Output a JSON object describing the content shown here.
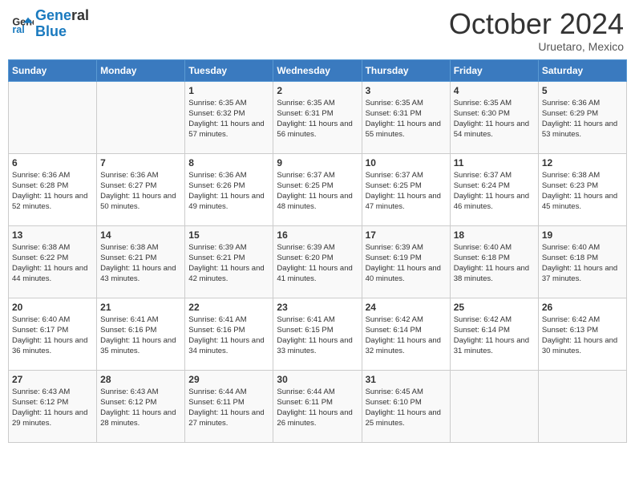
{
  "logo": {
    "line1": "General",
    "line2": "Blue"
  },
  "title": "October 2024",
  "subtitle": "Uruetaro, Mexico",
  "days_of_week": [
    "Sunday",
    "Monday",
    "Tuesday",
    "Wednesday",
    "Thursday",
    "Friday",
    "Saturday"
  ],
  "weeks": [
    [
      {
        "day": "",
        "info": ""
      },
      {
        "day": "",
        "info": ""
      },
      {
        "day": "1",
        "info": "Sunrise: 6:35 AM\nSunset: 6:32 PM\nDaylight: 11 hours and 57 minutes."
      },
      {
        "day": "2",
        "info": "Sunrise: 6:35 AM\nSunset: 6:31 PM\nDaylight: 11 hours and 56 minutes."
      },
      {
        "day": "3",
        "info": "Sunrise: 6:35 AM\nSunset: 6:31 PM\nDaylight: 11 hours and 55 minutes."
      },
      {
        "day": "4",
        "info": "Sunrise: 6:35 AM\nSunset: 6:30 PM\nDaylight: 11 hours and 54 minutes."
      },
      {
        "day": "5",
        "info": "Sunrise: 6:36 AM\nSunset: 6:29 PM\nDaylight: 11 hours and 53 minutes."
      }
    ],
    [
      {
        "day": "6",
        "info": "Sunrise: 6:36 AM\nSunset: 6:28 PM\nDaylight: 11 hours and 52 minutes."
      },
      {
        "day": "7",
        "info": "Sunrise: 6:36 AM\nSunset: 6:27 PM\nDaylight: 11 hours and 50 minutes."
      },
      {
        "day": "8",
        "info": "Sunrise: 6:36 AM\nSunset: 6:26 PM\nDaylight: 11 hours and 49 minutes."
      },
      {
        "day": "9",
        "info": "Sunrise: 6:37 AM\nSunset: 6:25 PM\nDaylight: 11 hours and 48 minutes."
      },
      {
        "day": "10",
        "info": "Sunrise: 6:37 AM\nSunset: 6:25 PM\nDaylight: 11 hours and 47 minutes."
      },
      {
        "day": "11",
        "info": "Sunrise: 6:37 AM\nSunset: 6:24 PM\nDaylight: 11 hours and 46 minutes."
      },
      {
        "day": "12",
        "info": "Sunrise: 6:38 AM\nSunset: 6:23 PM\nDaylight: 11 hours and 45 minutes."
      }
    ],
    [
      {
        "day": "13",
        "info": "Sunrise: 6:38 AM\nSunset: 6:22 PM\nDaylight: 11 hours and 44 minutes."
      },
      {
        "day": "14",
        "info": "Sunrise: 6:38 AM\nSunset: 6:21 PM\nDaylight: 11 hours and 43 minutes."
      },
      {
        "day": "15",
        "info": "Sunrise: 6:39 AM\nSunset: 6:21 PM\nDaylight: 11 hours and 42 minutes."
      },
      {
        "day": "16",
        "info": "Sunrise: 6:39 AM\nSunset: 6:20 PM\nDaylight: 11 hours and 41 minutes."
      },
      {
        "day": "17",
        "info": "Sunrise: 6:39 AM\nSunset: 6:19 PM\nDaylight: 11 hours and 40 minutes."
      },
      {
        "day": "18",
        "info": "Sunrise: 6:40 AM\nSunset: 6:18 PM\nDaylight: 11 hours and 38 minutes."
      },
      {
        "day": "19",
        "info": "Sunrise: 6:40 AM\nSunset: 6:18 PM\nDaylight: 11 hours and 37 minutes."
      }
    ],
    [
      {
        "day": "20",
        "info": "Sunrise: 6:40 AM\nSunset: 6:17 PM\nDaylight: 11 hours and 36 minutes."
      },
      {
        "day": "21",
        "info": "Sunrise: 6:41 AM\nSunset: 6:16 PM\nDaylight: 11 hours and 35 minutes."
      },
      {
        "day": "22",
        "info": "Sunrise: 6:41 AM\nSunset: 6:16 PM\nDaylight: 11 hours and 34 minutes."
      },
      {
        "day": "23",
        "info": "Sunrise: 6:41 AM\nSunset: 6:15 PM\nDaylight: 11 hours and 33 minutes."
      },
      {
        "day": "24",
        "info": "Sunrise: 6:42 AM\nSunset: 6:14 PM\nDaylight: 11 hours and 32 minutes."
      },
      {
        "day": "25",
        "info": "Sunrise: 6:42 AM\nSunset: 6:14 PM\nDaylight: 11 hours and 31 minutes."
      },
      {
        "day": "26",
        "info": "Sunrise: 6:42 AM\nSunset: 6:13 PM\nDaylight: 11 hours and 30 minutes."
      }
    ],
    [
      {
        "day": "27",
        "info": "Sunrise: 6:43 AM\nSunset: 6:12 PM\nDaylight: 11 hours and 29 minutes."
      },
      {
        "day": "28",
        "info": "Sunrise: 6:43 AM\nSunset: 6:12 PM\nDaylight: 11 hours and 28 minutes."
      },
      {
        "day": "29",
        "info": "Sunrise: 6:44 AM\nSunset: 6:11 PM\nDaylight: 11 hours and 27 minutes."
      },
      {
        "day": "30",
        "info": "Sunrise: 6:44 AM\nSunset: 6:11 PM\nDaylight: 11 hours and 26 minutes."
      },
      {
        "day": "31",
        "info": "Sunrise: 6:45 AM\nSunset: 6:10 PM\nDaylight: 11 hours and 25 minutes."
      },
      {
        "day": "",
        "info": ""
      },
      {
        "day": "",
        "info": ""
      }
    ]
  ]
}
